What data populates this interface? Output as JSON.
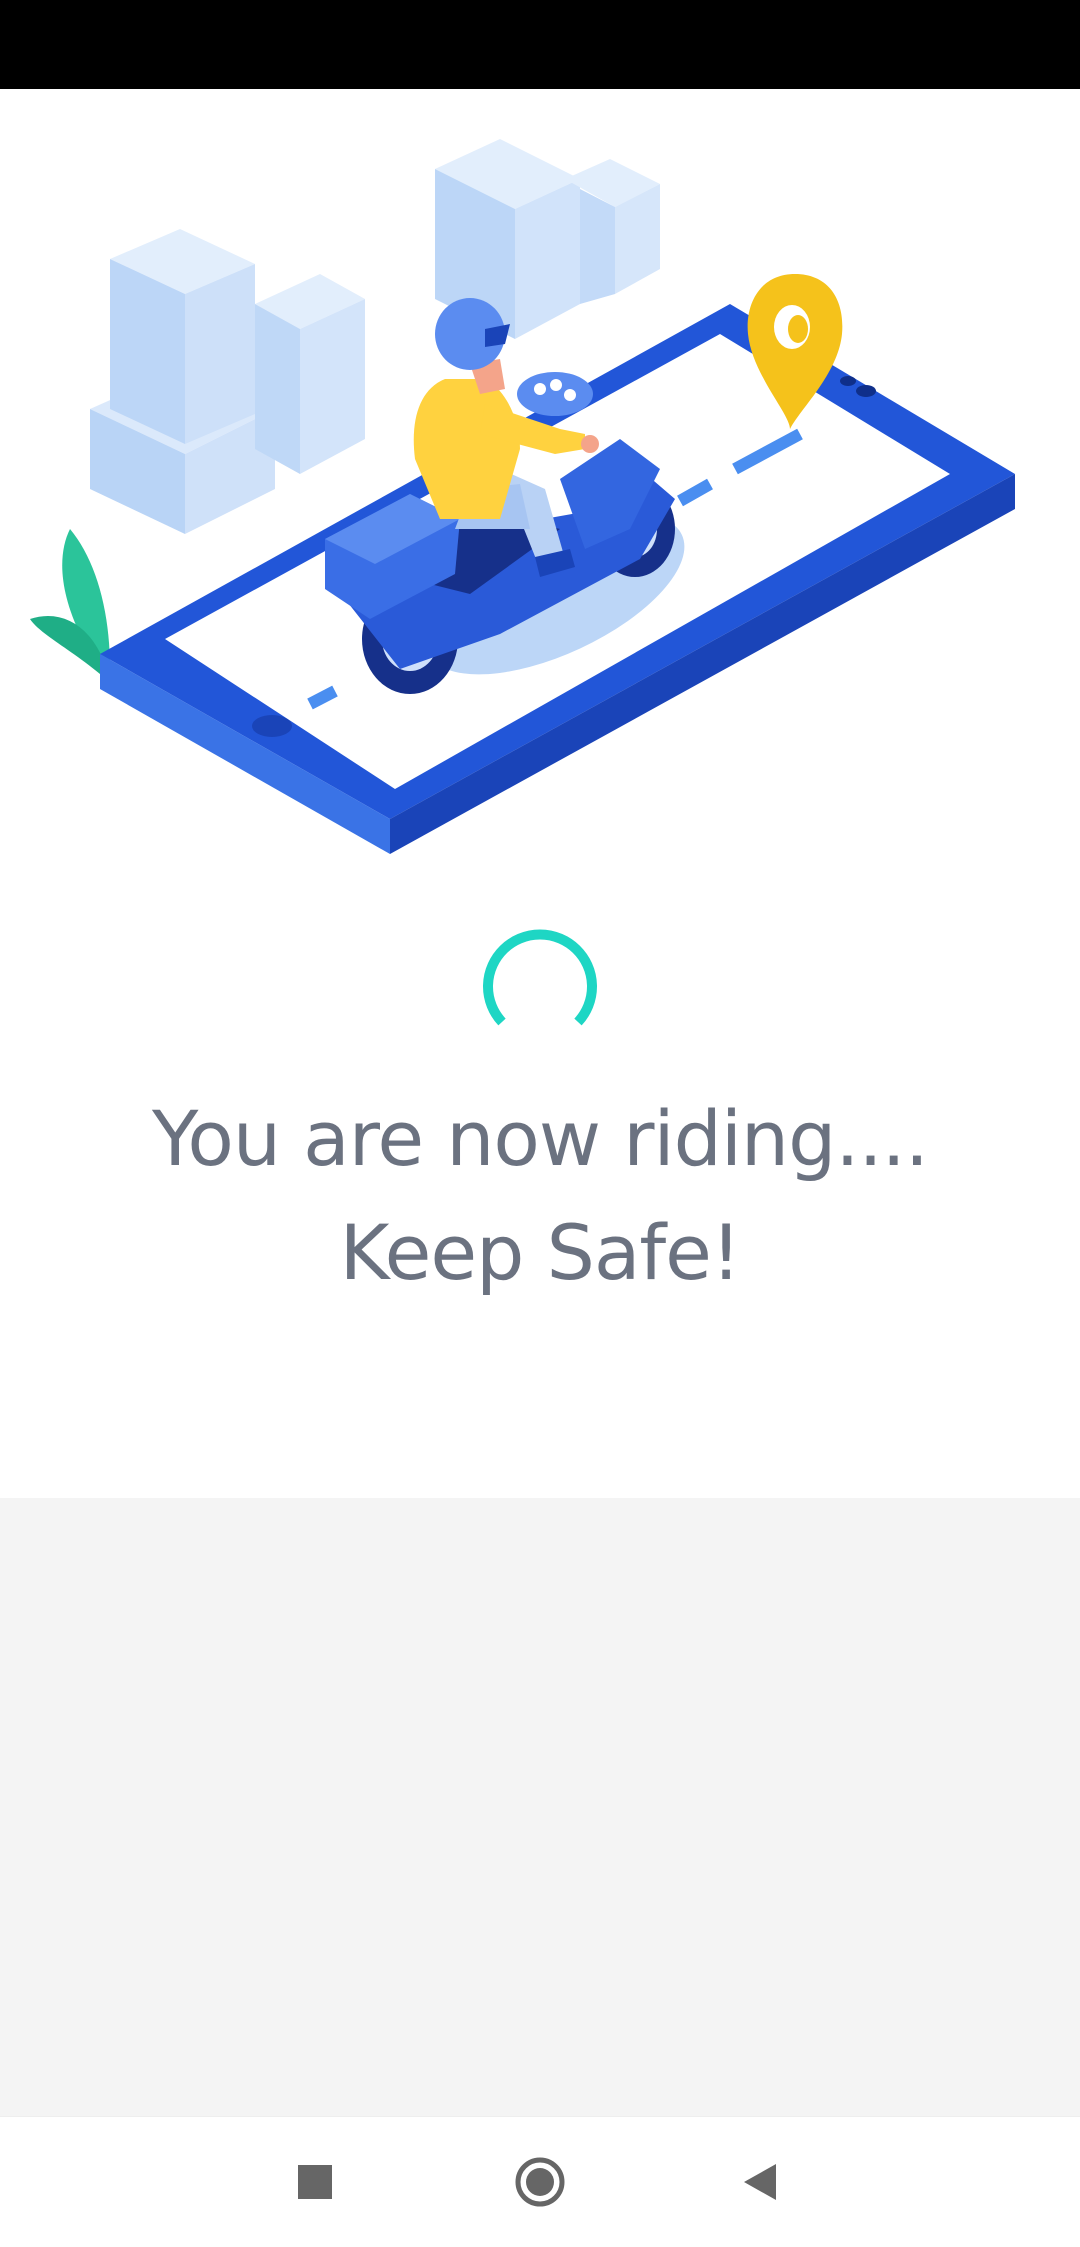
{
  "colors": {
    "status_bar": "#000000",
    "background": "#ffffff",
    "text": "#6b7280",
    "spinner": "#1ed6c4",
    "lower_area": "#f4f4f4",
    "nav_icons": "#666666"
  },
  "illustration": {
    "icon": "scooter-delivery-illustration"
  },
  "loading": {
    "icon": "loading-spinner"
  },
  "message": {
    "line1": "You are now riding....",
    "line2": "Keep Safe!"
  },
  "navigation": {
    "recent_icon": "square-icon",
    "home_icon": "circle-icon",
    "back_icon": "triangle-back-icon"
  }
}
